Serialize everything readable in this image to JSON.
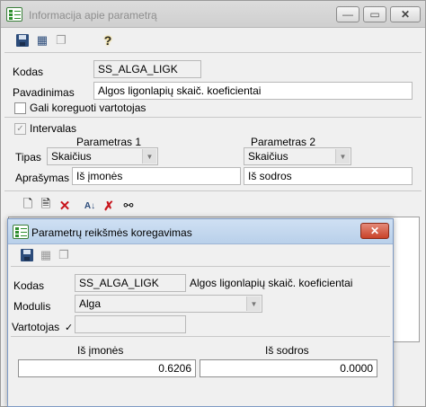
{
  "outer_window": {
    "title": "Informacija apie parametrą",
    "buttons": {
      "minimize": "—",
      "maximize": "▭",
      "close": "✕"
    },
    "toolbar": {
      "save_icon": "floppy-disk-icon",
      "edit_icon": "edit-form-icon",
      "copy_icon": "copy-icon",
      "help_icon": "help-icon",
      "help_glyph": "?"
    },
    "fields": {
      "kodas_label": "Kodas",
      "kodas_value": "SS_ALGA_LIGK",
      "pavadinimas_label": "Pavadinimas",
      "pavadinimas_value": "Algos ligonlapių skaič. koeficientai",
      "gali_koreguoti_label": "Gali koreguoti vartotojas",
      "intervalas_label": "Intervalas",
      "parametras1_header": "Parametras 1",
      "parametras2_header": "Parametras 2",
      "tipas_label": "Tipas",
      "tipas1_value": "Skaičius",
      "tipas2_value": "Skaičius",
      "aprasymas_label": "Aprašymas",
      "aprasymas1_value": "Iš įmonės",
      "aprasymas2_value": "Iš sodros"
    },
    "grid_toolbar": {
      "new_icon": "new-document-icon",
      "edit_icon": "edit-document-icon",
      "delete_icon": "delete-icon",
      "sort_icon": "sort-az-icon",
      "clear_icon": "clear-filter-icon",
      "find_icon": "binoculars-icon"
    }
  },
  "inner_window": {
    "title": "Parametrų reikšmės koregavimas",
    "buttons": {
      "close": "✕"
    },
    "fields": {
      "kodas_label": "Kodas",
      "kodas_value": "SS_ALGA_LIGK",
      "kodas_description": "Algos ligonlapių skaič. koeficientai",
      "modulis_label": "Modulis",
      "modulis_value": "Alga",
      "vartotojas_label": "Vartotojas",
      "vartotojas_value": "",
      "is_imones_header": "Iš įmonės",
      "is_sodros_header": "Iš sodros",
      "is_imones_value": "0.6206",
      "is_sodros_value": "0.0000"
    }
  }
}
